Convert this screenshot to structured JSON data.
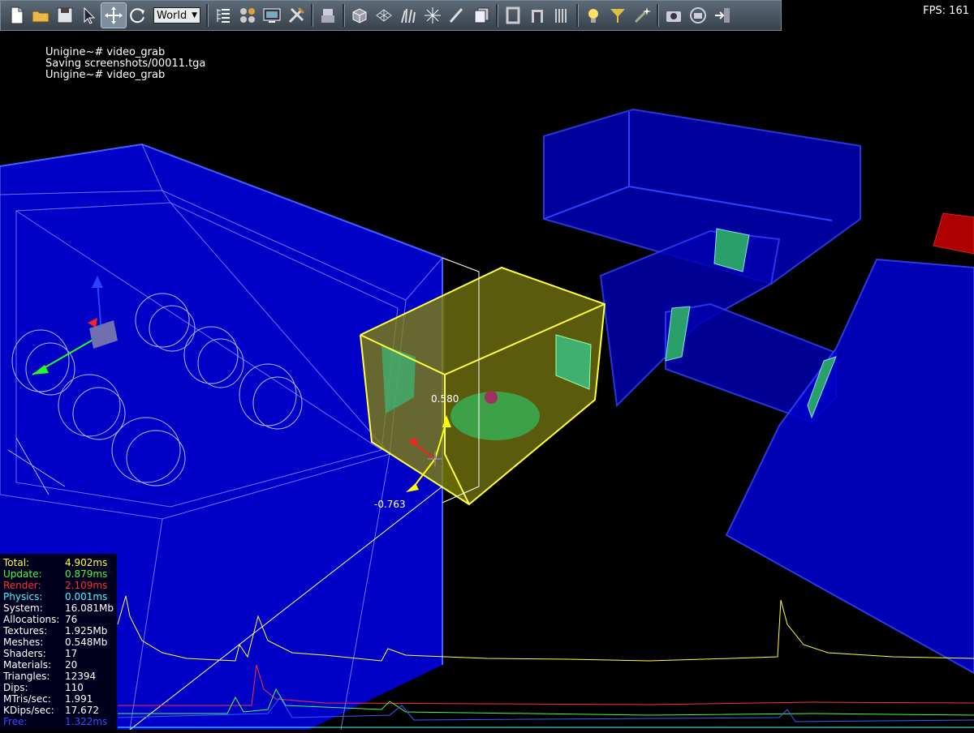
{
  "fps": "FPS: 161",
  "toolbar": {
    "world_select": "World",
    "buttons": [
      "new-file",
      "open-folder",
      "save",
      "select-arrow",
      "move",
      "rotate",
      "sep",
      "list-tree",
      "nodes",
      "monitor-settings",
      "tools",
      "sep",
      "robot",
      "sep",
      "cube",
      "mesh",
      "grass",
      "particles",
      "brush",
      "layers",
      "sep",
      "portal-a",
      "portal-b",
      "bars",
      "sep",
      "light",
      "player",
      "spark",
      "sep",
      "camera",
      "camera-rotate",
      "exit"
    ]
  },
  "console": [
    "Unigine~# video_grab",
    "Saving screenshots/00011.tga",
    "Unigine~# video_grab"
  ],
  "gizmo": {
    "y_value": "0.580",
    "x_value": "-0.763"
  },
  "stats": [
    {
      "label": "Total:",
      "value": "4.902ms",
      "color": "#ffff40"
    },
    {
      "label": "Update:",
      "value": "0.879ms",
      "color": "#40ff40"
    },
    {
      "label": "Render:",
      "value": "2.109ms",
      "color": "#ff3030"
    },
    {
      "label": "Physics:",
      "value": "0.001ms",
      "color": "#40ffff"
    },
    {
      "label": "System:",
      "value": "16.081Mb",
      "color": "#ffffff"
    },
    {
      "label": "Allocations:",
      "value": "76",
      "color": "#ffffff"
    },
    {
      "label": "Textures:",
      "value": "1.925Mb",
      "color": "#ffffff"
    },
    {
      "label": "Meshes:",
      "value": "0.548Mb",
      "color": "#ffffff"
    },
    {
      "label": "Shaders:",
      "value": "17",
      "color": "#ffffff"
    },
    {
      "label": "Materials:",
      "value": "20",
      "color": "#ffffff"
    },
    {
      "label": "Triangles:",
      "value": "12394",
      "color": "#ffffff"
    },
    {
      "label": "Dips:",
      "value": "110",
      "color": "#ffffff"
    },
    {
      "label": "MTris/sec:",
      "value": "1.991",
      "color": "#ffffff"
    },
    {
      "label": "KDips/sec:",
      "value": "17.672",
      "color": "#ffffff"
    },
    {
      "label": "Free:",
      "value": "1.322ms",
      "color": "#3050ff"
    }
  ],
  "colors": {
    "volume": "#0000e0",
    "selection": "#e0e000",
    "total_graph": "#ffff40",
    "render_graph": "#ff3030",
    "update_graph": "#40ff40",
    "physics_graph": "#40ffff"
  }
}
